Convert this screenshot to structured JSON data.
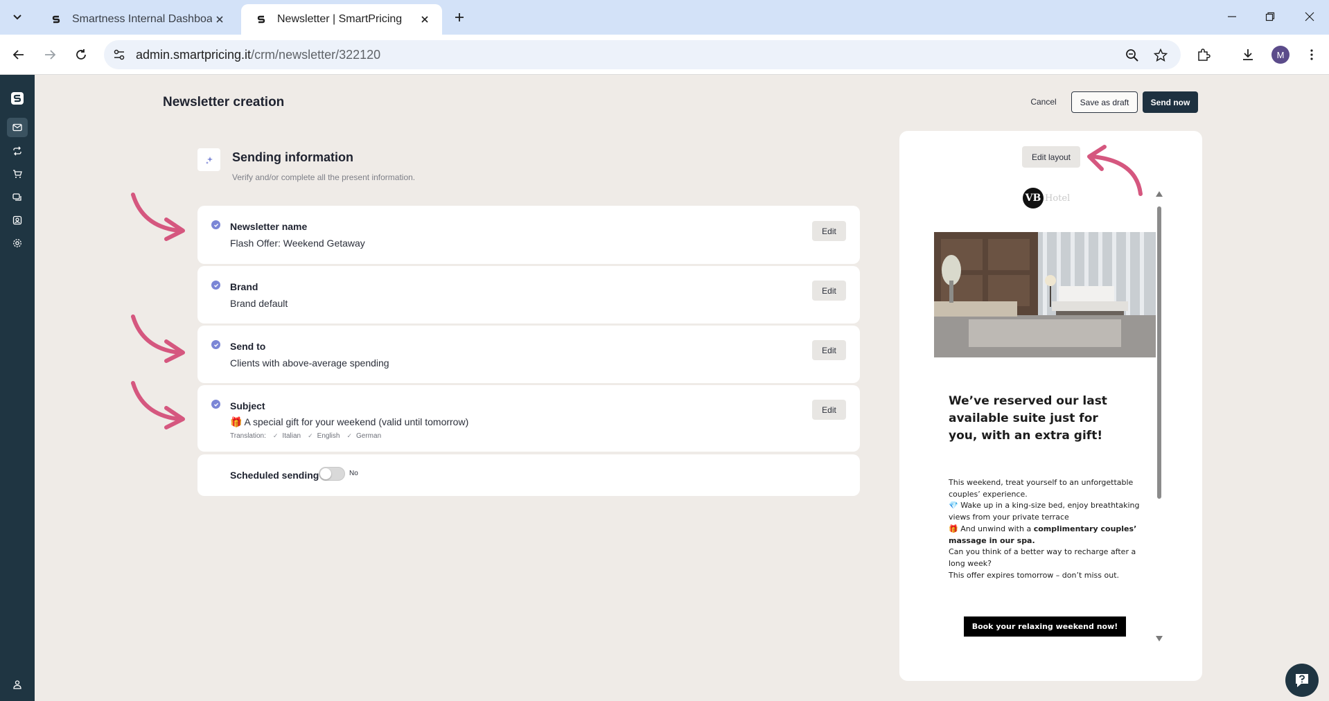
{
  "browser": {
    "tabs": [
      {
        "title": "Smartness Internal Dashboard",
        "active": false
      },
      {
        "title": "Newsletter | SmartPricing",
        "active": true
      }
    ],
    "url_host": "admin.smartpricing.it",
    "url_path": "/crm/newsletter/322120",
    "profile_initial": "M"
  },
  "header": {
    "title": "Newsletter creation",
    "cancel_label": "Cancel",
    "draft_label": "Save as draft",
    "send_label": "Send now"
  },
  "section": {
    "title": "Sending information",
    "subtitle": "Verify and/or complete all the present information."
  },
  "fields": {
    "name": {
      "label": "Newsletter name",
      "value": "Flash Offer: Weekend Getaway",
      "edit": "Edit"
    },
    "brand": {
      "label": "Brand",
      "value": "Brand default",
      "edit": "Edit"
    },
    "sendto": {
      "label": "Send to",
      "value": "Clients with above-average spending",
      "edit": "Edit"
    },
    "subject": {
      "label": "Subject",
      "value": "🎁 A special gift for your weekend (valid until tomorrow)",
      "edit": "Edit",
      "translation_label": "Translation:",
      "languages": [
        "Italian",
        "English",
        "German"
      ]
    },
    "scheduled": {
      "label": "Scheduled sending",
      "state": "No",
      "enabled": false
    }
  },
  "preview": {
    "edit_layout_label": "Edit layout",
    "logo_initials": "VB",
    "logo_word": "Hotel",
    "headline": "We’ve reserved our last available suite just for you, with an extra gift!",
    "body": [
      "This weekend, treat yourself to an unforgettable couples’ experience.",
      "💎 Wake up in a king-size bed, enjoy breathtaking views from your private terrace",
      "🎁 And unwind with a ",
      "complimentary couples’ massage in our spa.",
      "Can you think of a better way to recharge after a long week?",
      "This offer expires tomorrow – don’t miss out."
    ],
    "cta": "Book your relaxing weekend now!"
  },
  "colors": {
    "page_bg": "#efebe7",
    "sidebar_bg": "#1f3542",
    "primary_button": "#1e3140",
    "check_accent": "#7b86d6",
    "annotation_arrow": "#d5577f"
  }
}
